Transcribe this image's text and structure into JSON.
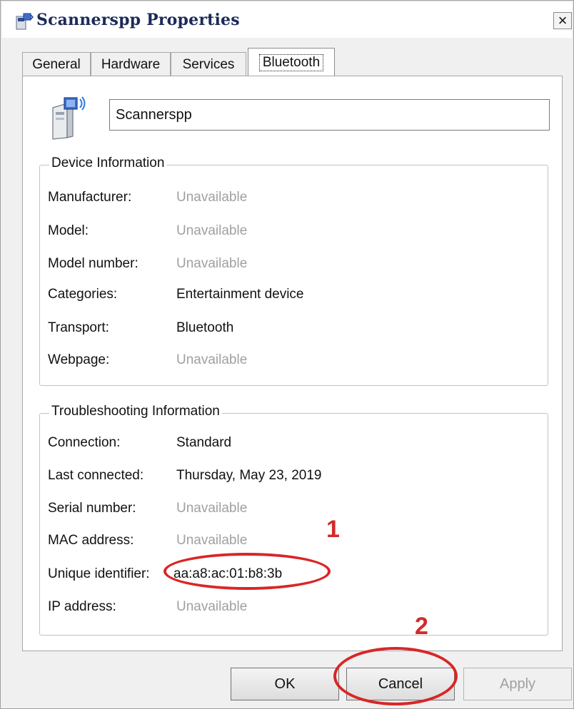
{
  "window": {
    "title": "Scannerspp Properties",
    "close_label": "×"
  },
  "tabs": [
    {
      "label": "General"
    },
    {
      "label": "Hardware"
    },
    {
      "label": "Services"
    },
    {
      "label": "Bluetooth",
      "active": true
    }
  ],
  "device": {
    "name_value": "Scannerspp",
    "icon": "bluetooth-device-icon"
  },
  "device_info": {
    "title": "Device Information",
    "rows": [
      {
        "label": "Manufacturer:",
        "value": "Unavailable"
      },
      {
        "label": "Model:",
        "value": "Unavailable"
      },
      {
        "label": "Model number:",
        "value": "Unavailable"
      },
      {
        "label": "Categories:",
        "value": "Entertainment device"
      },
      {
        "label": "Transport:",
        "value": "Bluetooth"
      },
      {
        "label": "Webpage:",
        "value": "Unavailable"
      }
    ]
  },
  "troubleshooting": {
    "title": "Troubleshooting Information",
    "rows": [
      {
        "label": "Connection:",
        "value": "Standard"
      },
      {
        "label": "Last connected:",
        "value": "Thursday, May 23, 2019"
      },
      {
        "label": "Serial number:",
        "value": "Unavailable"
      },
      {
        "label": "MAC address:",
        "value": "Unavailable"
      },
      {
        "label": "Unique identifier:",
        "value": "aa:a8:ac:01:b8:3b"
      },
      {
        "label": "IP address:",
        "value": "Unavailable"
      }
    ]
  },
  "buttons": {
    "ok": "OK",
    "cancel": "Cancel",
    "apply": "Apply"
  },
  "annotations": {
    "marker_1": "1",
    "marker_2": "2",
    "color": "#d92626"
  }
}
